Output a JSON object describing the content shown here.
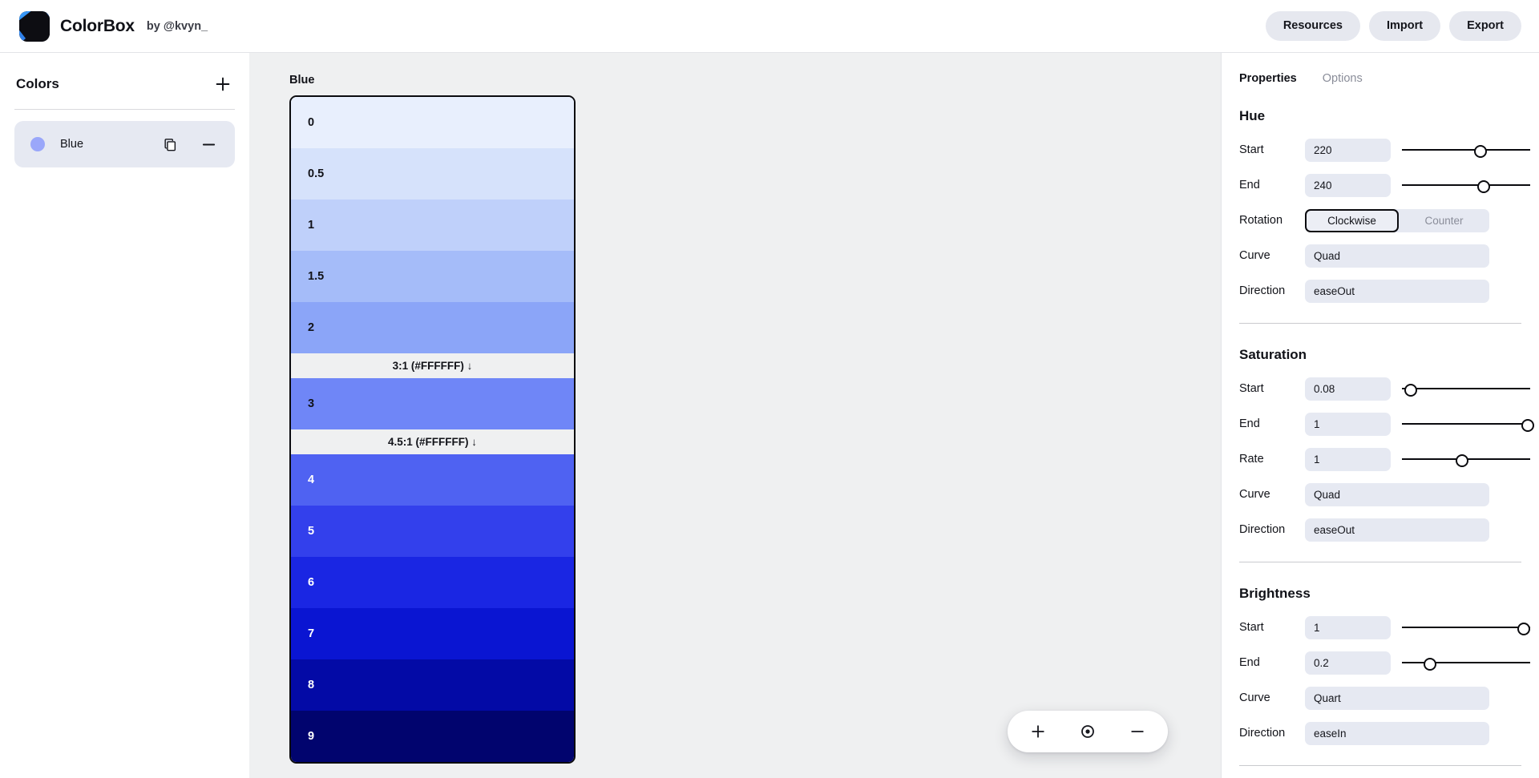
{
  "header": {
    "brand_name": "ColorBox",
    "brand_by": "by @kvyn_",
    "logo_icon": "colorbox-logo-icon",
    "buttons": [
      {
        "label": "Resources",
        "name": "resources-button"
      },
      {
        "label": "Import",
        "name": "import-button"
      },
      {
        "label": "Export",
        "name": "export-button"
      }
    ]
  },
  "sidebar": {
    "title": "Colors",
    "add_icon": "plus-icon",
    "items": [
      {
        "label": "Blue",
        "dot_color": "#9aa7fa",
        "copy_icon": "copy-icon",
        "remove_icon": "minus-icon",
        "selected": true
      }
    ]
  },
  "canvas": {
    "ramp_title": "Blue",
    "rows": [
      {
        "kind": "swatch",
        "label": "0",
        "color": "#e8effd",
        "text_color": "#111218"
      },
      {
        "kind": "swatch",
        "label": "0.5",
        "color": "#d6e2fb",
        "text_color": "#111218"
      },
      {
        "kind": "swatch",
        "label": "1",
        "color": "#bfd0fa",
        "text_color": "#111218"
      },
      {
        "kind": "swatch",
        "label": "1.5",
        "color": "#a5bcf9",
        "text_color": "#111218"
      },
      {
        "kind": "swatch",
        "label": "2",
        "color": "#8ba5f8",
        "text_color": "#111218"
      },
      {
        "kind": "marker",
        "label": "3:1 (#FFFFFF) ↓",
        "color": "#eff0f1",
        "text_color": "#111218"
      },
      {
        "kind": "swatch",
        "label": "3",
        "color": "#6f86f7",
        "text_color": "#111218"
      },
      {
        "kind": "marker",
        "label": "4.5:1 (#FFFFFF) ↓",
        "color": "#eff0f1",
        "text_color": "#111218"
      },
      {
        "kind": "swatch",
        "label": "4",
        "color": "#4f62f2",
        "text_color": "#ffffff"
      },
      {
        "kind": "swatch",
        "label": "5",
        "color": "#3340ec",
        "text_color": "#ffffff"
      },
      {
        "kind": "swatch",
        "label": "6",
        "color": "#1a26e3",
        "text_color": "#ffffff"
      },
      {
        "kind": "swatch",
        "label": "7",
        "color": "#0a15d2",
        "text_color": "#ffffff"
      },
      {
        "kind": "swatch",
        "label": "8",
        "color": "#030aa6",
        "text_color": "#ffffff"
      },
      {
        "kind": "swatch",
        "label": "9",
        "color": "#01046e",
        "text_color": "#ffffff"
      }
    ],
    "zoom_controls": [
      {
        "name": "zoom-in-button",
        "icon": "plus-icon"
      },
      {
        "name": "zoom-reset-button",
        "icon": "target-dot-icon"
      },
      {
        "name": "zoom-out-button",
        "icon": "minus-icon"
      }
    ]
  },
  "properties": {
    "tabs": [
      {
        "label": "Properties",
        "active": true
      },
      {
        "label": "Options",
        "active": false
      }
    ],
    "hue": {
      "title": "Hue",
      "start_label": "Start",
      "start_value": "220",
      "start_slider_pct": 61,
      "end_label": "End",
      "end_value": "240",
      "end_slider_pct": 64,
      "rotation_label": "Rotation",
      "rotation_options": [
        {
          "label": "Clockwise",
          "active": true
        },
        {
          "label": "Counter",
          "active": false
        }
      ],
      "curve_label": "Curve",
      "curve_value": "Quad",
      "direction_label": "Direction",
      "direction_value": "easeOut"
    },
    "saturation": {
      "title": "Saturation",
      "start_label": "Start",
      "start_value": "0.08",
      "start_slider_pct": 7,
      "end_label": "End",
      "end_value": "1",
      "end_slider_pct": 98,
      "rate_label": "Rate",
      "rate_value": "1",
      "rate_slider_pct": 47,
      "curve_label": "Curve",
      "curve_value": "Quad",
      "direction_label": "Direction",
      "direction_value": "easeOut"
    },
    "brightness": {
      "title": "Brightness",
      "start_label": "Start",
      "start_value": "1",
      "start_slider_pct": 95,
      "end_label": "End",
      "end_value": "0.2",
      "end_slider_pct": 22,
      "curve_label": "Curve",
      "curve_value": "Quart",
      "direction_label": "Direction",
      "direction_value": "easeIn"
    }
  }
}
